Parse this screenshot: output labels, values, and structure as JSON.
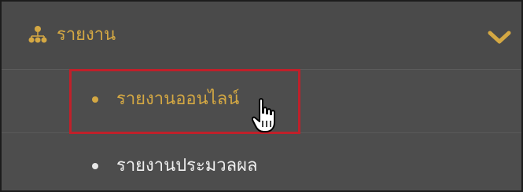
{
  "menu": {
    "section_label": "รายงาน",
    "section_icon": "sitemap-icon",
    "expand_icon": "chevron-down-icon",
    "items": [
      {
        "label": "รายงานออนไลน์",
        "state": "hovered"
      },
      {
        "label": "รายงานประมวลผล",
        "state": "normal"
      }
    ]
  },
  "colors": {
    "accent": "#d4a843",
    "background": "#4c4c4c",
    "highlight": "#c0202a",
    "text_light": "#f0f0f0"
  }
}
